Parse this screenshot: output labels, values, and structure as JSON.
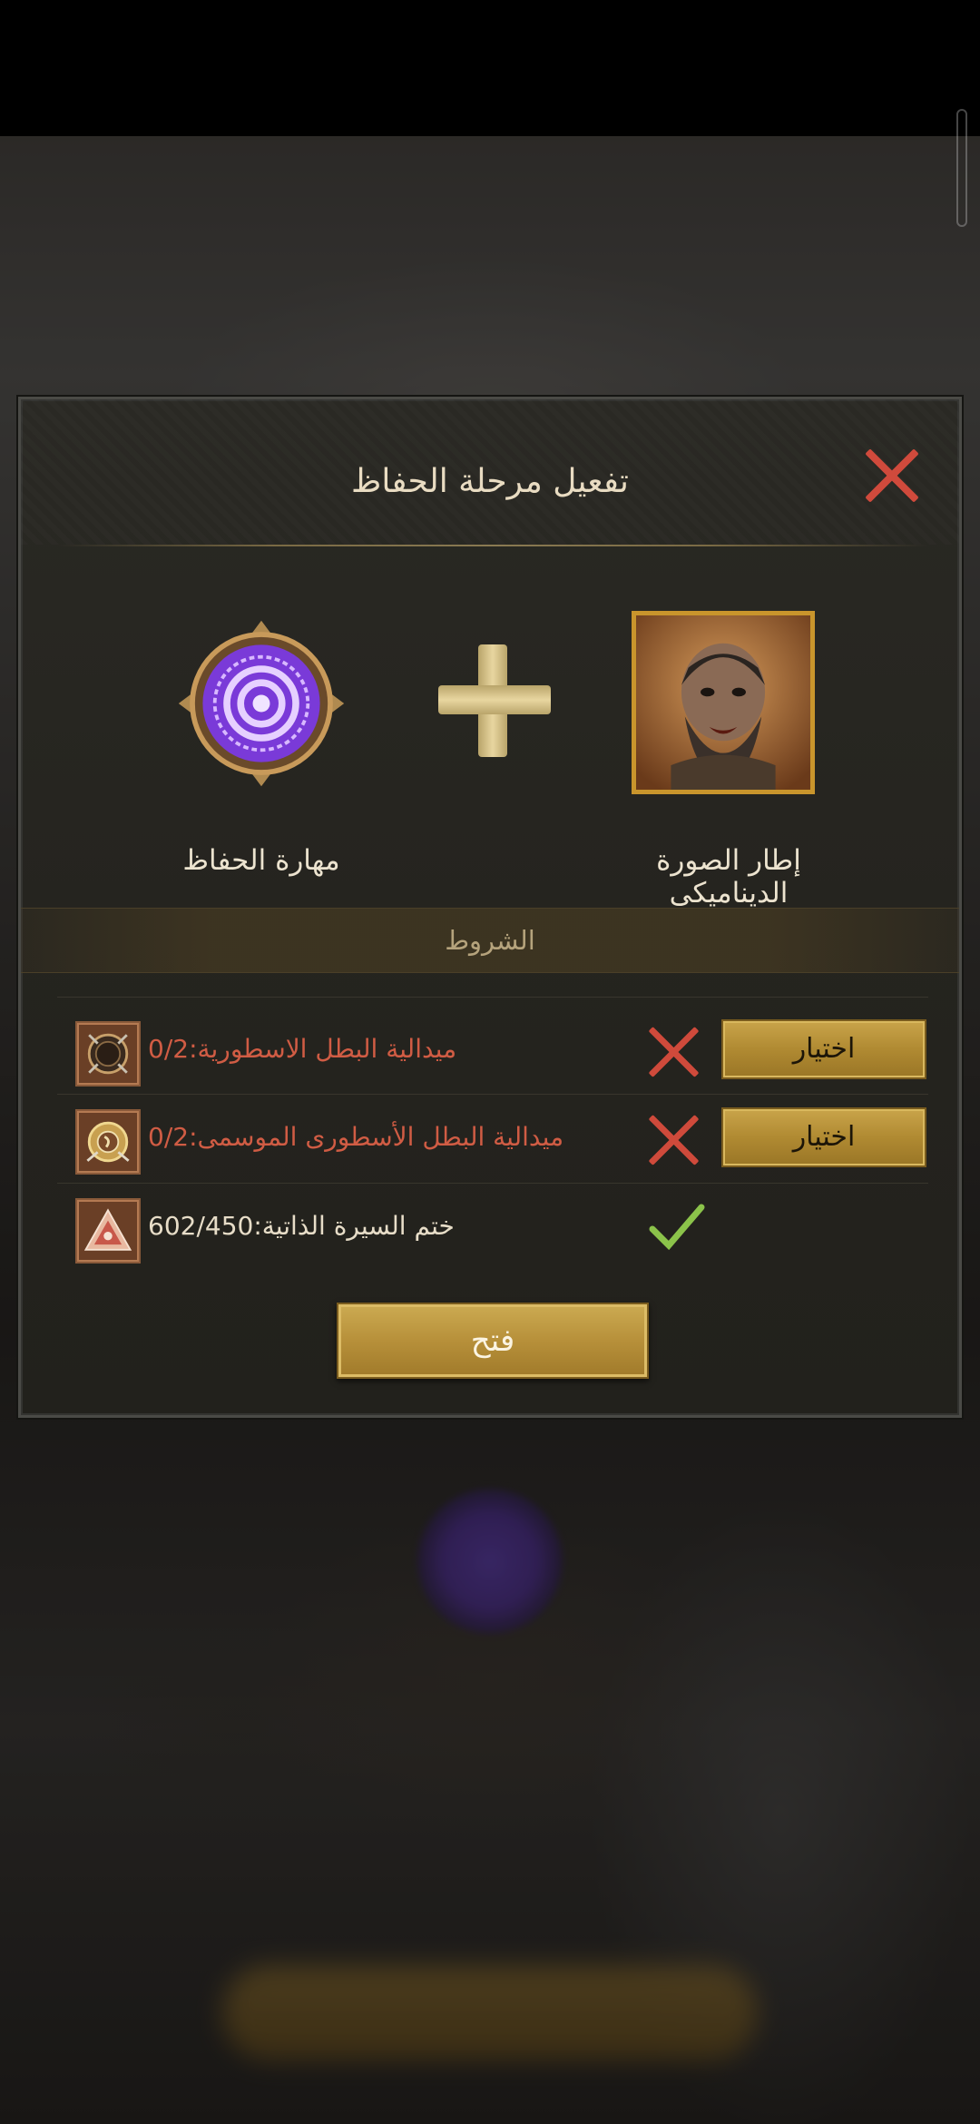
{
  "dialog": {
    "title": "تفعيل مرحلة الحفاظ",
    "close_icon": "close-icon",
    "items": {
      "left": {
        "label": "مهارة الحفاظ",
        "icon": "keeper-skill-icon"
      },
      "right": {
        "label": "إطار الصورة الديناميكى",
        "icon": "dynamic-avatar-frame"
      },
      "plus_icon": "plus-icon"
    },
    "conditions": {
      "title": "الشروط",
      "rows": [
        {
          "text": "ميدالية البطل الاسطورية:0/2",
          "icon": "legendary-hero-medal-icon",
          "status": "unmet",
          "button": "اختيار"
        },
        {
          "text": "ميدالية البطل الأسطورى الموسمى:0/2",
          "icon": "seasonal-legendary-medal-icon",
          "status": "unmet",
          "button": "اختيار"
        },
        {
          "text": "ختم السيرة الذاتية:602/450",
          "icon": "biography-seal-icon",
          "status": "met"
        }
      ]
    },
    "open_button": "فتح"
  },
  "colors": {
    "accent_gold": "#c9a44a",
    "unmet_red": "#d05c44",
    "met_green": "#8bc34a",
    "close_red": "#d04a3c"
  }
}
